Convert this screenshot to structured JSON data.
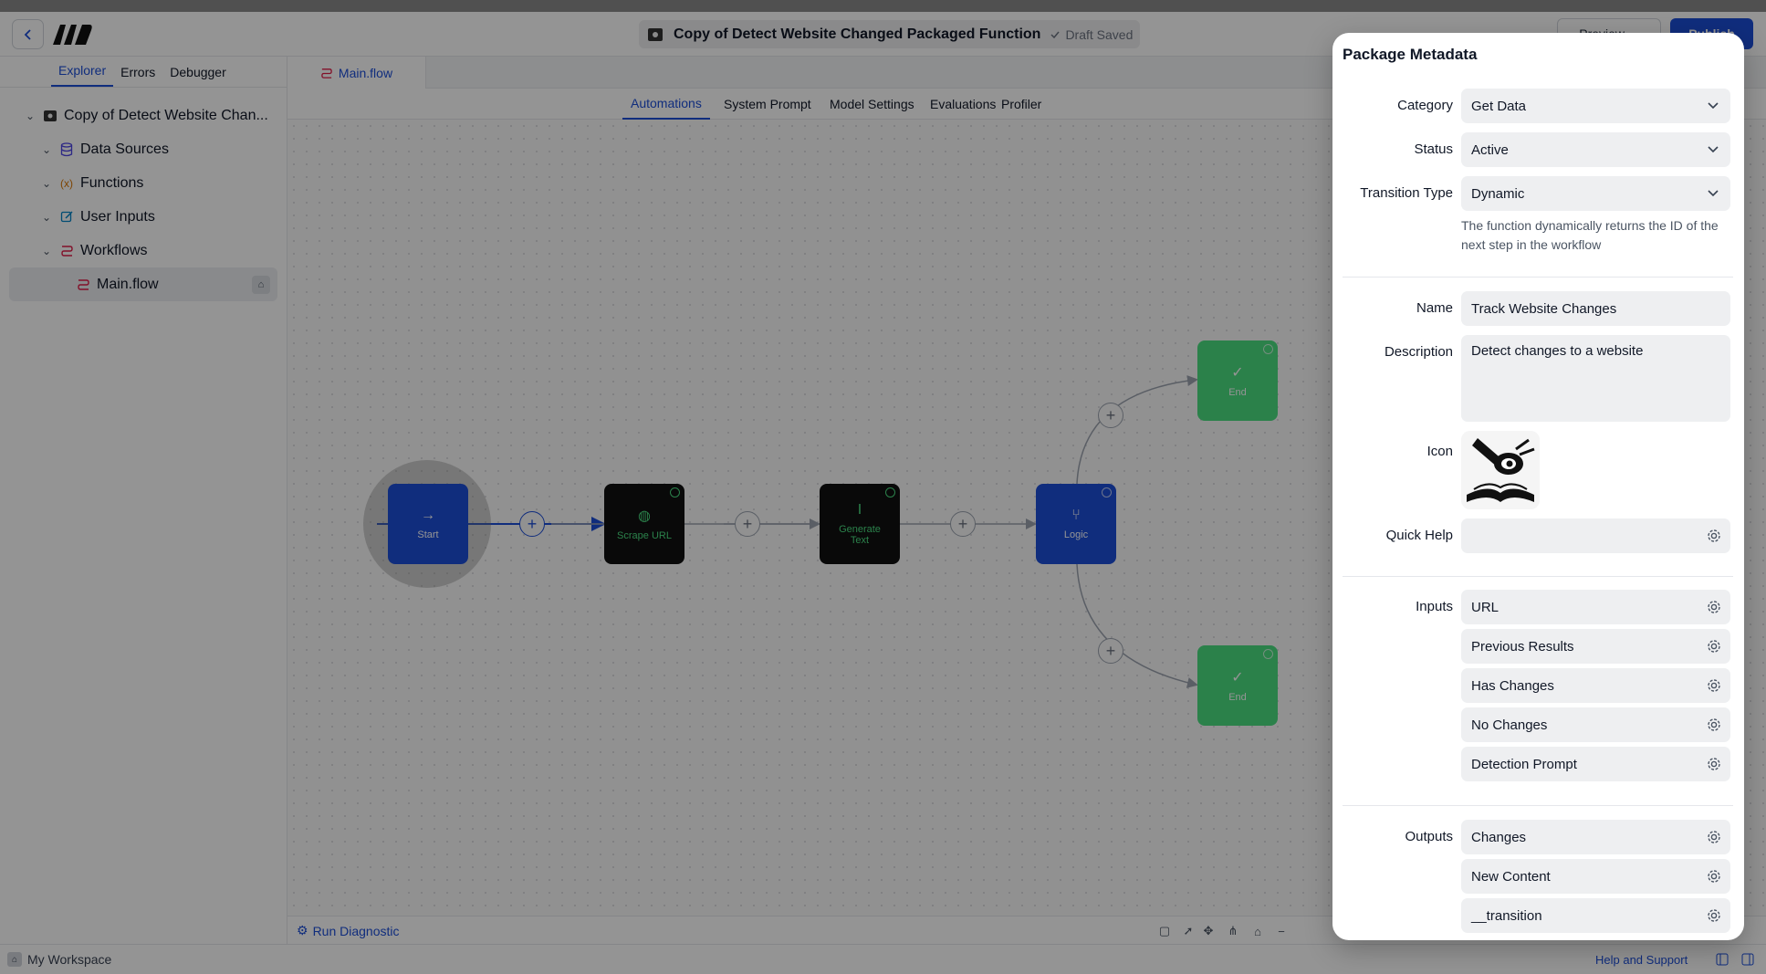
{
  "topbar": {
    "title": "Copy of Detect Website Changed Packaged Function",
    "draft_status": "Draft Saved",
    "preview_label": "Preview",
    "publish_label": "Publish"
  },
  "left_panel": {
    "tabs": [
      "Explorer",
      "Errors",
      "Debugger"
    ],
    "tree": {
      "root": "Copy of Detect Website Chan...",
      "data_sources": "Data Sources",
      "functions": "Functions",
      "user_inputs": "User Inputs",
      "workflows": "Workflows",
      "main_flow": "Main.flow"
    }
  },
  "editor": {
    "file_tab": "Main.flow",
    "sub_tabs": [
      "Automations",
      "System Prompt",
      "Model Settings",
      "Evaluations",
      "Profiler"
    ],
    "nodes": {
      "start": "Start",
      "scrape": "Scrape URL",
      "generate": "Generate Text",
      "logic": "Logic",
      "end_top": "End",
      "end_bottom": "End"
    },
    "run_diagnostic": "Run Diagnostic"
  },
  "status_bar": {
    "workspace": "My Workspace",
    "help": "Help and Support"
  },
  "modal": {
    "title": "Package Metadata",
    "labels": {
      "category": "Category",
      "status": "Status",
      "transition_type": "Transition Type",
      "name": "Name",
      "description": "Description",
      "icon": "Icon",
      "quick_help": "Quick Help",
      "inputs": "Inputs",
      "outputs": "Outputs"
    },
    "values": {
      "category": "Get Data",
      "status": "Active",
      "transition_type": "Dynamic",
      "transition_note": "The function dynamically returns the ID of the next step in the workflow",
      "name": "Track Website Changes",
      "description": "Detect changes to a website",
      "quick_help": ""
    },
    "inputs": [
      "URL",
      "Previous Results",
      "Has Changes",
      "No Changes",
      "Detection Prompt"
    ],
    "outputs": [
      "Changes",
      "New Content",
      "__transition"
    ]
  },
  "colors": {
    "accent": "#1d4ed8",
    "node_green": "#4ade80",
    "node_dark": "#111111"
  }
}
